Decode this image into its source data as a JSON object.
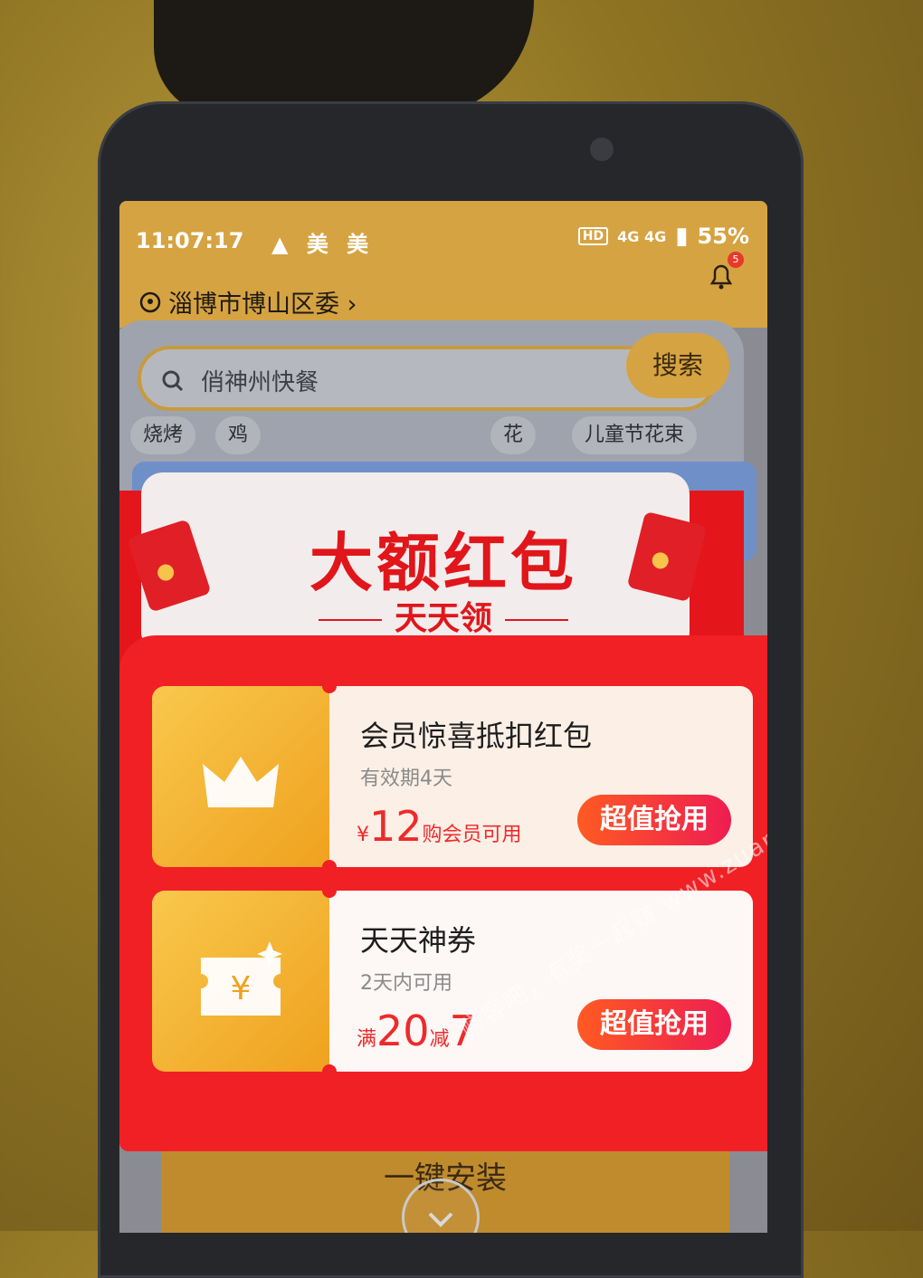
{
  "status_bar": {
    "time": "11:07:17",
    "app_icons": "▲ 美 美",
    "hd": "HD",
    "network": "4G 4G",
    "battery": "55%"
  },
  "header": {
    "location": "淄博市博山区委 ›",
    "notification_count": "5"
  },
  "search": {
    "placeholder": "俏神州快餐",
    "button": "搜索"
  },
  "chips": [
    "烧烤",
    "鸡",
    "花",
    "儿童节花束"
  ],
  "popup": {
    "title": "大额红包",
    "subtitle": "天天领",
    "coupons": [
      {
        "title": "会员惊喜抵扣红包",
        "validity": "有效期4天",
        "currency": "¥",
        "amount": "12",
        "condition": "购会员可用",
        "button": "超值抢用"
      },
      {
        "title": "天天神券",
        "validity": "2天内可用",
        "prefix": "满",
        "threshold": "20",
        "mid": "减",
        "discount": "7",
        "button": "超值抢用"
      }
    ]
  },
  "install_button": "一键安装",
  "watermark": "赚客吧，有奖一起赚 www.zuanke8.com",
  "colors": {
    "header": "#d6a342",
    "popup_red": "#f12025",
    "accent_gold": "#f0a11e"
  }
}
